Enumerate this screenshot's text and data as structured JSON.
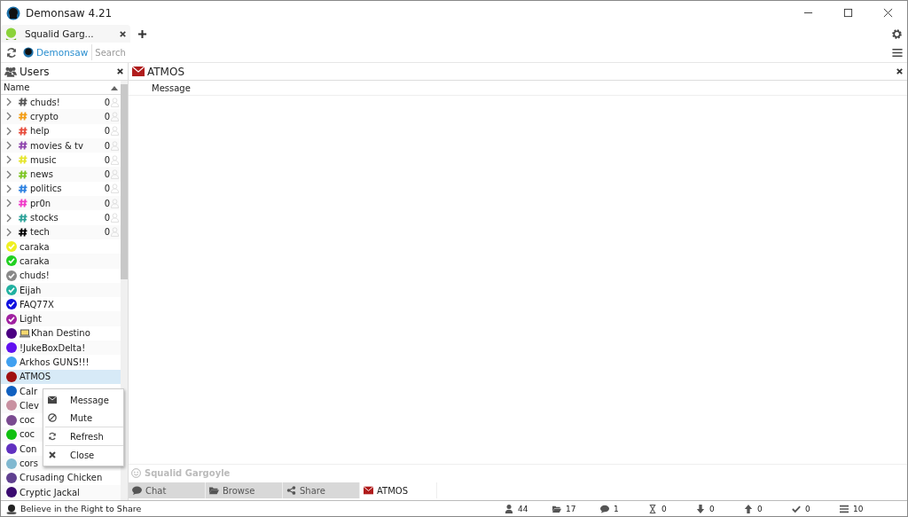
{
  "window": {
    "title": "Demonsaw 4.21"
  },
  "tabs": [
    {
      "label": "Squalid Garg...",
      "selected": true
    }
  ],
  "toolbar": {
    "network": "Demonsaw",
    "search": {
      "placeholder": "Search"
    }
  },
  "users_panel": {
    "title": "Users",
    "column": "Name",
    "items": [
      {
        "kind": "room",
        "name": "chuds!",
        "color": "#555555",
        "count": "0"
      },
      {
        "kind": "room",
        "name": "crypto",
        "color": "#f39c12",
        "count": "0"
      },
      {
        "kind": "room",
        "name": "help",
        "color": "#e74c3c",
        "count": "0"
      },
      {
        "kind": "room",
        "name": "movies & tv",
        "color": "#8e44ad",
        "count": "0"
      },
      {
        "kind": "room",
        "name": "music",
        "color": "#e5e52a",
        "count": "0"
      },
      {
        "kind": "room",
        "name": "news",
        "color": "#7cc520",
        "count": "0"
      },
      {
        "kind": "room",
        "name": "politics",
        "color": "#2a7fe0",
        "count": "0"
      },
      {
        "kind": "room",
        "name": "pr0n",
        "color": "#f038c8",
        "count": "0"
      },
      {
        "kind": "room",
        "name": "stocks",
        "color": "#2aa198",
        "count": "0"
      },
      {
        "kind": "room",
        "name": "tech",
        "color": "#000000",
        "count": "0"
      },
      {
        "kind": "user",
        "name": "caraka",
        "color": "#f0f020",
        "checked": true,
        "selected": false
      },
      {
        "kind": "user",
        "name": "caraka",
        "color": "#20d020",
        "checked": true,
        "selected": false
      },
      {
        "kind": "user",
        "name": "chuds!",
        "color": "#888888",
        "checked": true,
        "selected": false
      },
      {
        "kind": "user",
        "name": "Eijah",
        "color": "#20b0a0",
        "checked": true,
        "selected": false
      },
      {
        "kind": "user",
        "name": "FAQ77X",
        "color": "#1010e0",
        "checked": true,
        "selected": false
      },
      {
        "kind": "user",
        "name": "Light",
        "color": "#a020a0",
        "checked": true,
        "selected": false
      },
      {
        "kind": "user",
        "name": "Khan Destino",
        "color": "#4b0082",
        "checked": false,
        "selected": false,
        "device": true
      },
      {
        "kind": "user",
        "name": "!JukeBoxDelta!",
        "color": "#6010f0",
        "checked": false,
        "selected": false
      },
      {
        "kind": "user",
        "name": "Arkhos GUNS!!!",
        "color": "#40a0f0",
        "checked": false,
        "selected": false
      },
      {
        "kind": "user",
        "name": "ATMOS",
        "color": "#a01010",
        "checked": false,
        "selected": true
      },
      {
        "kind": "user",
        "name": "Calr",
        "color": "#1060c0",
        "checked": false,
        "selected": false
      },
      {
        "kind": "user",
        "name": "Clev",
        "color": "#c890a0",
        "checked": false,
        "selected": false
      },
      {
        "kind": "user",
        "name": "coc",
        "color": "#7a4a90",
        "checked": false,
        "selected": false
      },
      {
        "kind": "user",
        "name": "coc",
        "color": "#10c010",
        "checked": false,
        "selected": false
      },
      {
        "kind": "user",
        "name": "Con",
        "color": "#6030c0",
        "checked": false,
        "selected": false
      },
      {
        "kind": "user",
        "name": "cors",
        "color": "#80b8d0",
        "checked": false,
        "selected": false
      },
      {
        "kind": "user",
        "name": "Crusading Chicken",
        "color": "#604090",
        "checked": false,
        "selected": false
      },
      {
        "kind": "user",
        "name": "Cryptic Jackal",
        "color": "#3a0a70",
        "checked": false,
        "selected": false
      }
    ]
  },
  "context_menu": [
    {
      "kind": "message",
      "label": "Message"
    },
    {
      "kind": "mute",
      "label": "Mute"
    },
    {
      "kind": "refresh",
      "label": "Refresh"
    },
    {
      "kind": "close",
      "label": "Close"
    }
  ],
  "message_panel": {
    "title": "ATMOS",
    "column": "Message",
    "input": {
      "placeholder": "Squalid Gargoyle"
    }
  },
  "bottom_tabs": [
    {
      "kind": "chat",
      "label": "Chat",
      "selected": false
    },
    {
      "kind": "browse",
      "label": "Browse",
      "selected": false
    },
    {
      "kind": "share",
      "label": "Share",
      "selected": false
    },
    {
      "kind": "message",
      "label": "ATMOS",
      "selected": true
    }
  ],
  "status_bar": {
    "motto": "Believe in the Right to Share",
    "stats": [
      {
        "kind": "users",
        "value": "44"
      },
      {
        "kind": "folder",
        "value": "17"
      },
      {
        "kind": "chat",
        "value": "1"
      },
      {
        "kind": "hourglass",
        "value": "0"
      },
      {
        "kind": "down",
        "value": "0"
      },
      {
        "kind": "up",
        "value": "0"
      },
      {
        "kind": "check",
        "value": "0"
      },
      {
        "kind": "list",
        "value": "10"
      }
    ]
  }
}
